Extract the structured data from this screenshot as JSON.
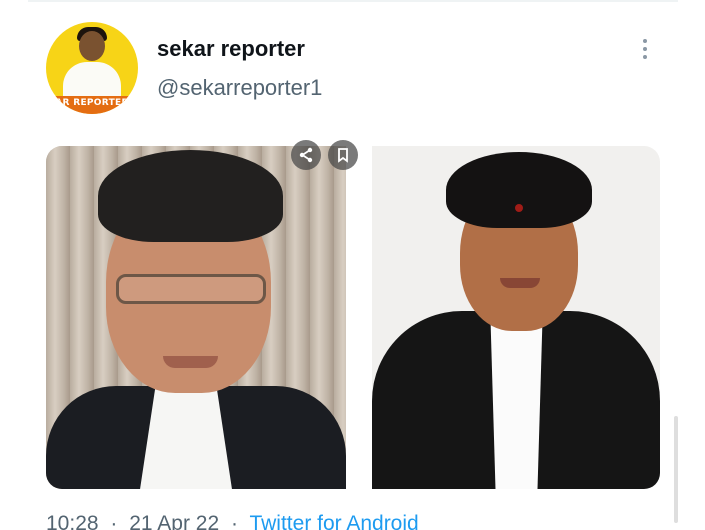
{
  "tweet": {
    "display_name": "sekar reporter",
    "handle": "@sekarreporter1",
    "avatar_badge_text": "AR REPORTER",
    "more_icon": "more-vertical-icon",
    "media": {
      "share_icon": "share-icon",
      "bookmark_icon": "bookmark-icon",
      "photo_count": 2
    },
    "footer": {
      "time": "10:28",
      "date": "21 Apr 22",
      "separator": "·",
      "source": "Twitter for Android"
    }
  },
  "colors": {
    "text_primary": "#0f1419",
    "text_secondary": "#536471",
    "link": "#1d9bf0",
    "avatar_bg": "#f7d417"
  }
}
